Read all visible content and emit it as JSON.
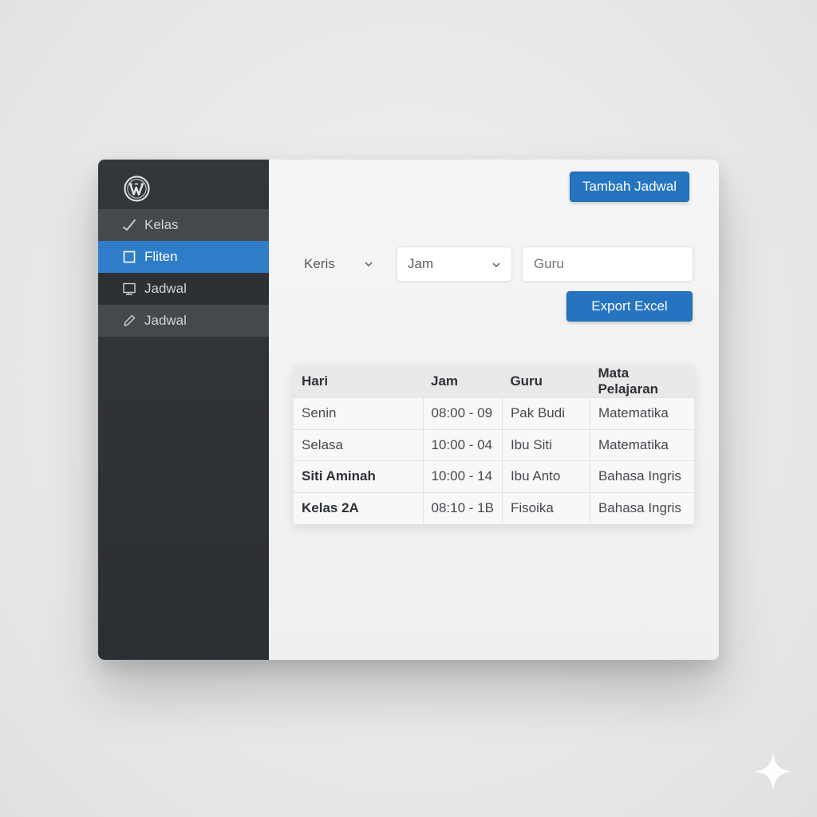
{
  "sidebar": {
    "items": [
      {
        "label": "Kelas",
        "icon": "check-icon"
      },
      {
        "label": "Fliten",
        "icon": "square-icon"
      },
      {
        "label": "Jadwal",
        "icon": "monitor-icon"
      },
      {
        "label": "Jadwal",
        "icon": "pencil-icon"
      }
    ]
  },
  "toolbar": {
    "add_label": "Tambah Jadwal",
    "export_label": "Export Excel"
  },
  "filters": {
    "kelas_value": "Keris",
    "jam_value": "Jam",
    "guru_placeholder": "Guru"
  },
  "table": {
    "headers": [
      "Hari",
      "Jam",
      "Guru",
      "Mata Pelajaran"
    ],
    "rows": [
      [
        "Senin",
        "08:00 - 09",
        "Pak Budi",
        "Matematika"
      ],
      [
        "Selasa",
        "10:00 - 04",
        "Ibu Siti",
        "Matematika"
      ],
      [
        "Siti Aminah",
        "10:00 - 14",
        "Ibu Anto",
        "Bahasa Ingris"
      ],
      [
        "Kelas 2A",
        "08:10 - 1B",
        "Fisoika",
        "Bahasa Ingris"
      ]
    ]
  },
  "colors": {
    "accent": "#2474c0",
    "sidebar": "#2f3236",
    "active": "#2f7dc9"
  }
}
